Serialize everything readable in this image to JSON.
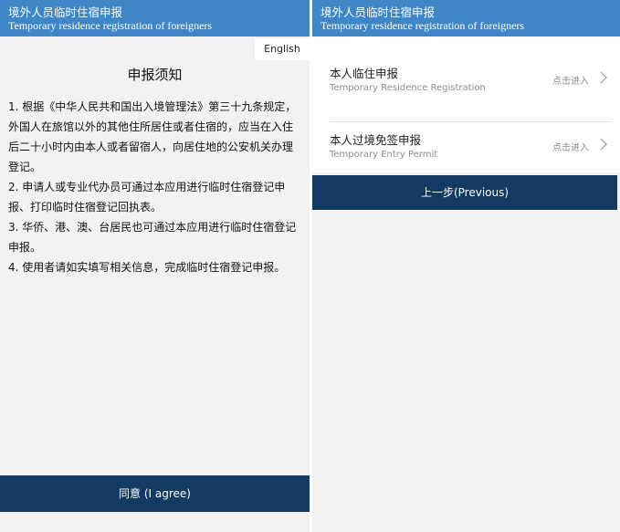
{
  "header": {
    "title_cn": "境外人员临时住宿申报",
    "title_en": "Temporary residence registration of foreigners"
  },
  "left": {
    "language_button": "English",
    "notice_title": "申报须知",
    "paragraphs": [
      "1. 根据《中华人民共和国出入境管理法》第三十九条规定，外国人在旅馆以外的其他住所居住或者住宿的，应当在入住后二十小时内由本人或者留宿人，向居住地的公安机关办理登记。",
      "2. 申请人或专业代办员可通过本应用进行临时住宿登记申报、打印临时住宿登记回执表。",
      "3. 华侨、港、澳、台居民也可通过本应用进行临时住宿登记申报。",
      "4. 使用者请如实填写相关信息，完成临时住宿登记申报。"
    ],
    "agree_button": "同意 (I agree)"
  },
  "right": {
    "items": [
      {
        "title": "本人临住申报",
        "subtitle": "Temporary Residence Registration",
        "action": "点击进入",
        "icon": "chevron-right-icon"
      },
      {
        "title": "本人过境免签申报",
        "subtitle": "Temporary Entry Permit",
        "action": "点击进入",
        "icon": "chevron-right-icon"
      }
    ],
    "previous_button": "上一步(Previous)"
  },
  "colors": {
    "header_bg": "#3e86c6",
    "button_bg": "#123a63",
    "panel_bg": "#f2f2f2"
  }
}
